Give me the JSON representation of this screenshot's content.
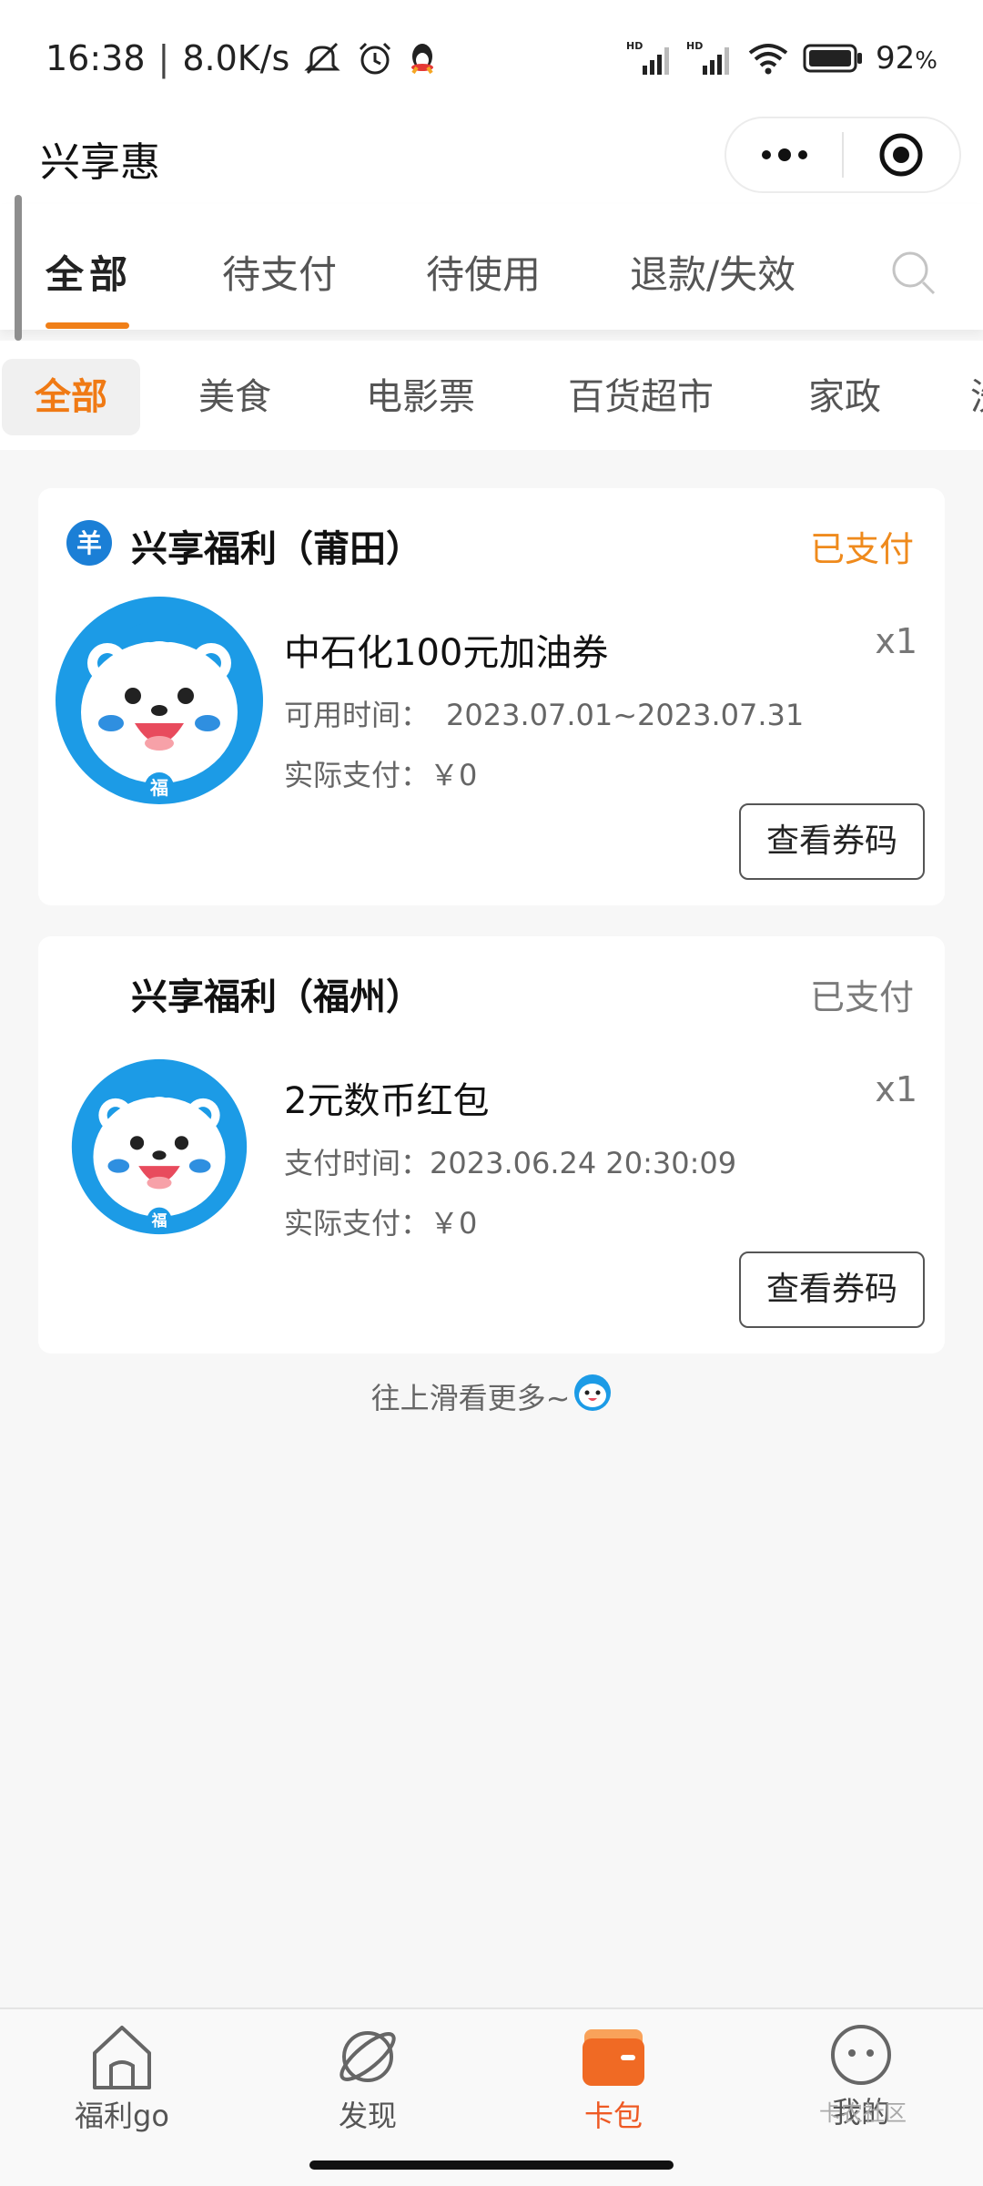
{
  "status_bar": {
    "time": "16:38",
    "net_speed": "8.0K/s",
    "battery": "92",
    "battery_unit": "%",
    "icons": [
      "mute-icon",
      "alarm-icon",
      "qq-icon",
      "signal-hd-icon",
      "signal-hd-icon",
      "wifi-icon",
      "battery-icon"
    ]
  },
  "header": {
    "title": "兴享惠",
    "more_icon": "more-dots-icon",
    "close_icon": "target-circle-icon"
  },
  "status_tabs": {
    "items": [
      {
        "label": "全部",
        "active": true
      },
      {
        "label": "待支付",
        "active": false
      },
      {
        "label": "待使用",
        "active": false
      },
      {
        "label": "退款/失效",
        "active": false
      }
    ],
    "search_icon": "search-icon",
    "accent": "#f07f18"
  },
  "category_tabs": {
    "items": [
      {
        "label": "全部",
        "active": true
      },
      {
        "label": "美食",
        "active": false
      },
      {
        "label": "电影票",
        "active": false
      },
      {
        "label": "百货超市",
        "active": false
      },
      {
        "label": "家政",
        "active": false
      },
      {
        "label": "洗",
        "active": false
      }
    ]
  },
  "orders": [
    {
      "merchant": "兴享福利（莆田）",
      "status": "已支付",
      "status_color": "#ef8a1c",
      "product": "中石化100元加油券",
      "quantity": "x1",
      "time_label": "可用时间：",
      "time_value": "2023.07.01~2023.07.31",
      "pay_label": "实际支付：",
      "pay_value": "￥0",
      "button": "查看券码"
    },
    {
      "merchant": "兴享福利（福州）",
      "status": "已支付",
      "status_color": "#7a7a7a",
      "product": "2元数币红包",
      "quantity": "x1",
      "time_label": "支付时间：",
      "time_value": "2023.06.24 20:30:09",
      "pay_label": "实际支付：",
      "pay_value": "￥0",
      "button": "查看券码"
    }
  ],
  "more_hint": "往上滑看更多~",
  "bottom_nav": {
    "items": [
      {
        "label": "福利go",
        "icon": "home-icon",
        "active": false
      },
      {
        "label": "发现",
        "icon": "planet-icon",
        "active": false
      },
      {
        "label": "卡包",
        "icon": "wallet-icon",
        "active": true
      },
      {
        "label": "我的",
        "icon": "face-icon",
        "active": false
      }
    ],
    "active_color": "#ee5a24"
  },
  "watermark": "卡农社区"
}
